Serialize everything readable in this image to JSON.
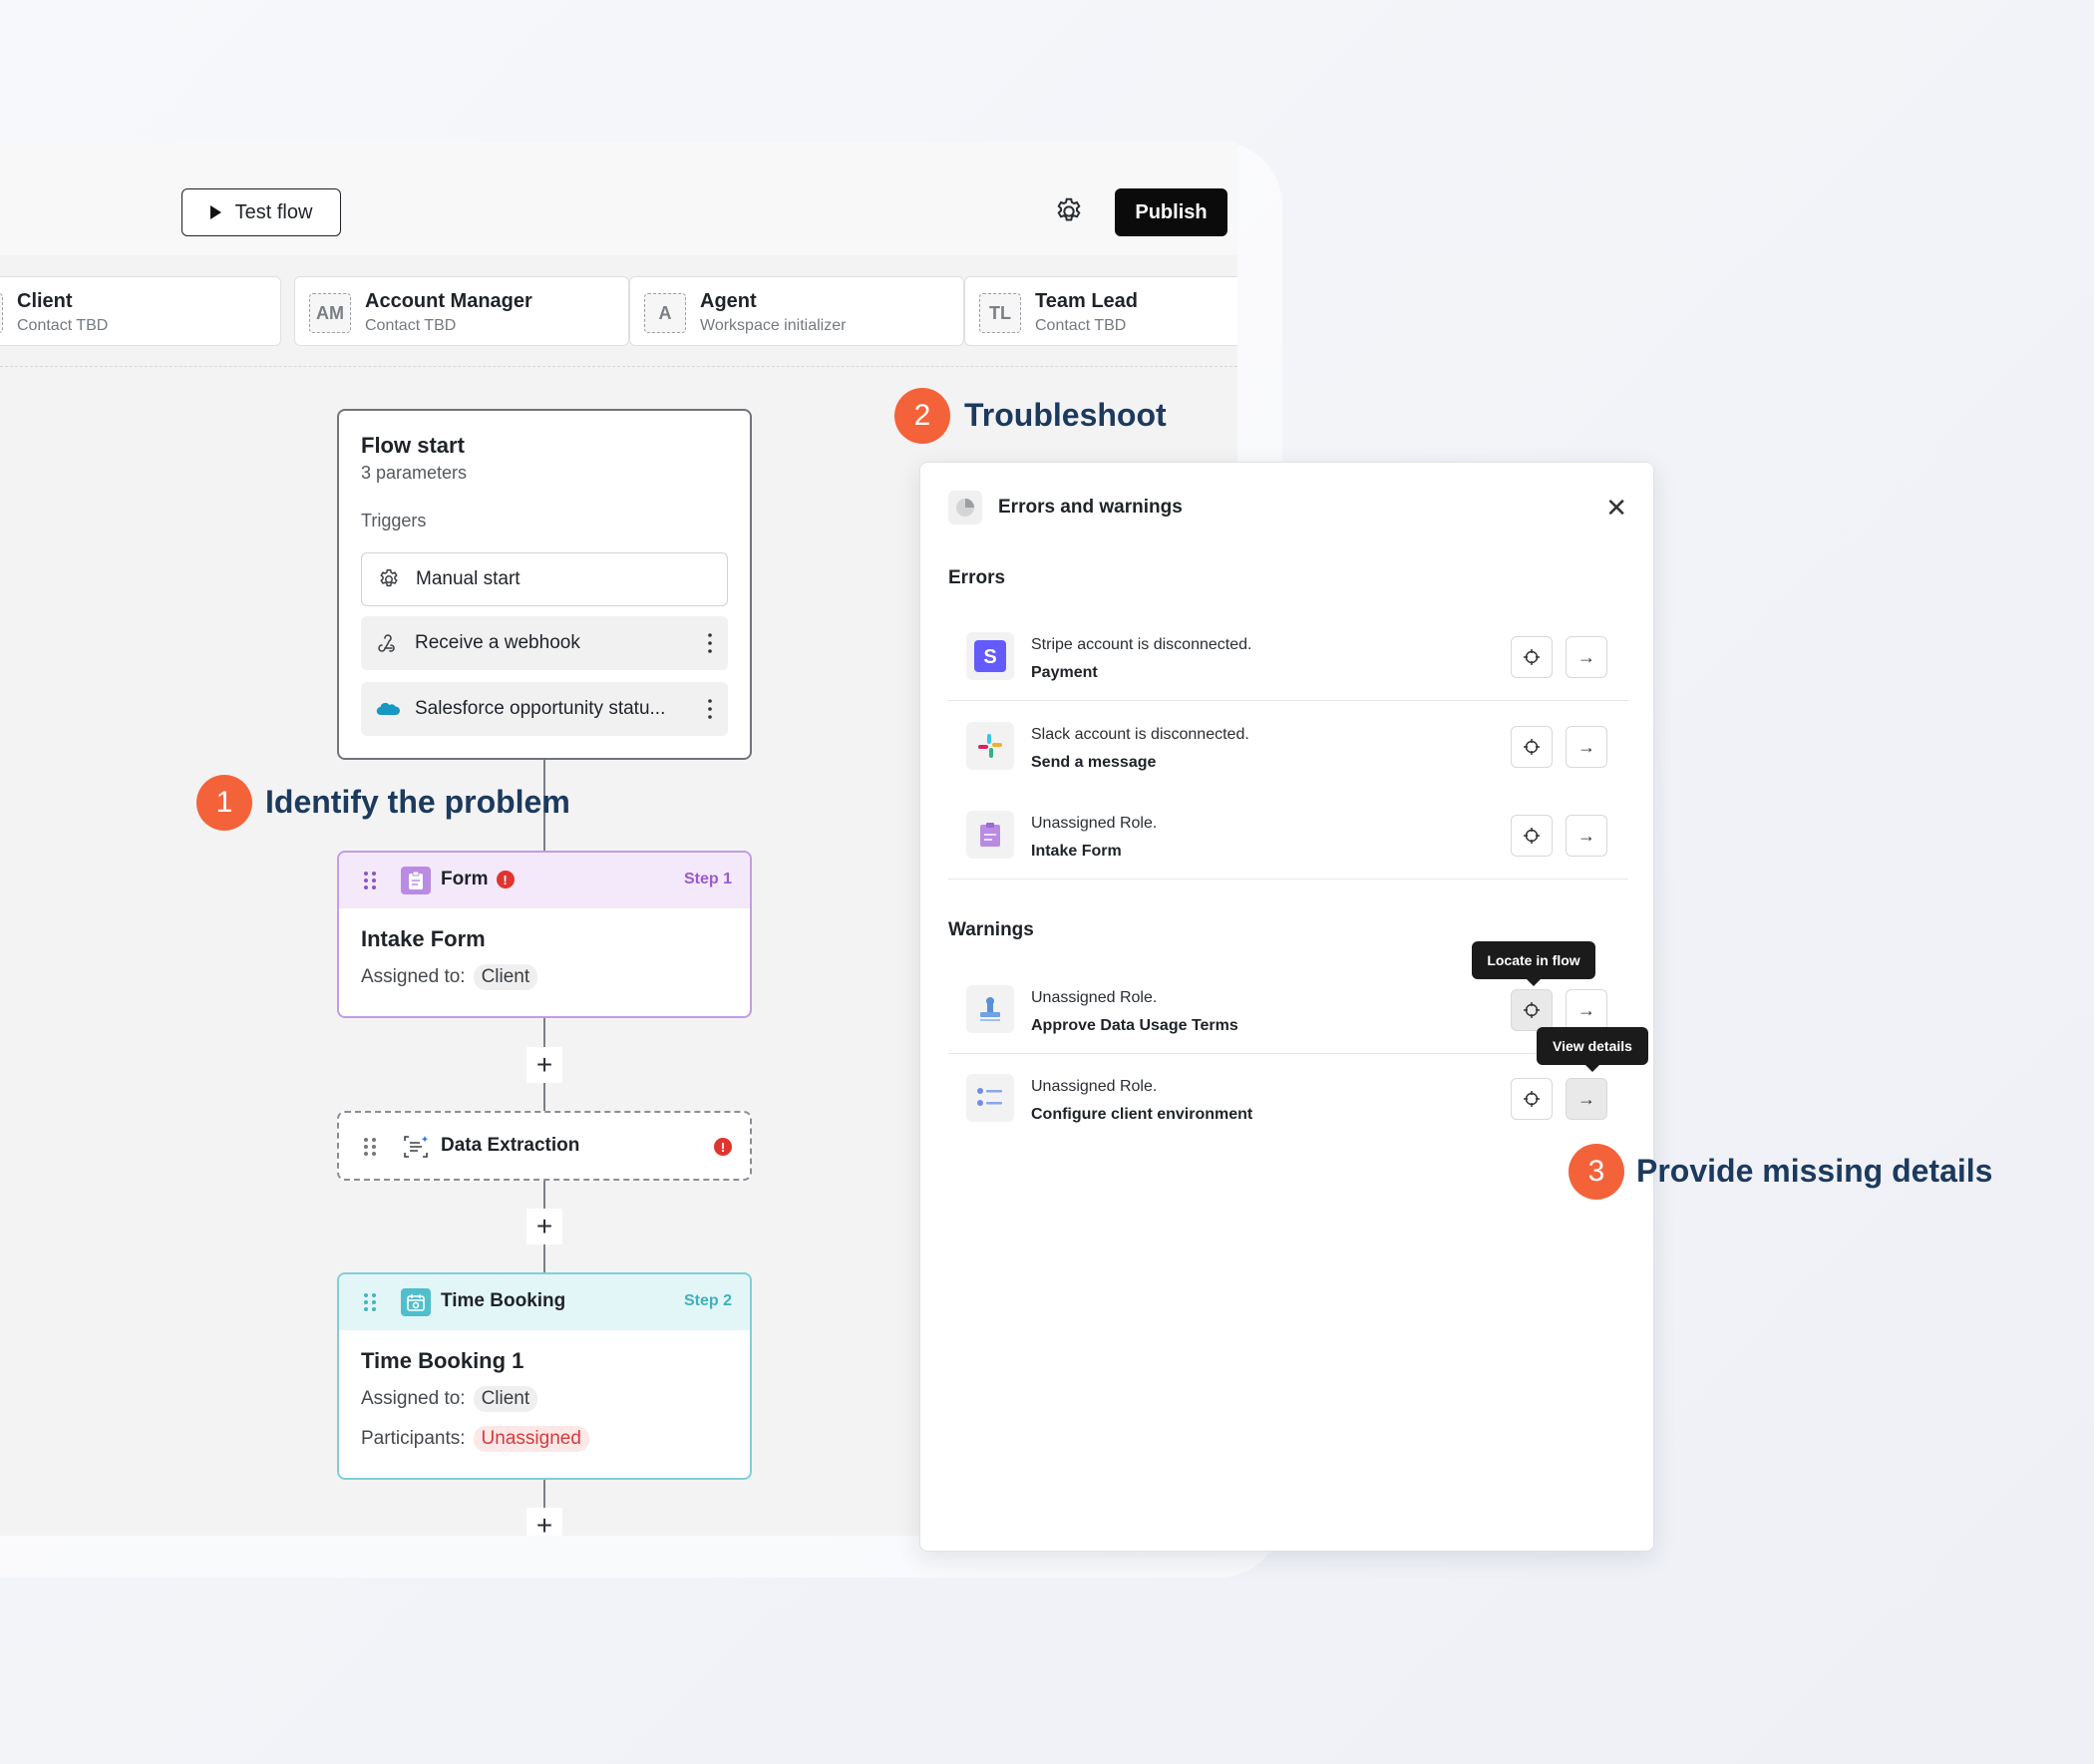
{
  "toolbar": {
    "test_flow_label": "Test flow",
    "publish_label": "Publish"
  },
  "roles": [
    {
      "initials": "C",
      "name": "Client",
      "subtitle": "Contact TBD"
    },
    {
      "initials": "AM",
      "name": "Account Manager",
      "subtitle": "Contact TBD"
    },
    {
      "initials": "A",
      "name": "Agent",
      "subtitle": "Workspace initializer"
    },
    {
      "initials": "TL",
      "name": "Team Lead",
      "subtitle": "Contact TBD"
    }
  ],
  "flow_start": {
    "title": "Flow start",
    "parameters": "3 parameters",
    "triggers_label": "Triggers",
    "triggers": [
      {
        "label": "Manual start",
        "icon": "gear-icon"
      },
      {
        "label": "Receive a webhook",
        "icon": "webhook-icon"
      },
      {
        "label": "Salesforce opportunity statu...",
        "icon": "salesforce-icon"
      }
    ]
  },
  "nodes": {
    "form": {
      "type": "Form",
      "step": "Step 1",
      "title": "Intake Form",
      "assigned_label": "Assigned to:",
      "assigned_value": "Client"
    },
    "extraction": {
      "type": "Data Extraction"
    },
    "booking": {
      "type": "Time Booking",
      "step": "Step 2",
      "title": "Time Booking 1",
      "assigned_label": "Assigned to:",
      "assigned_value": "Client",
      "participants_label": "Participants:",
      "participants_value": "Unassigned"
    }
  },
  "callouts": [
    {
      "number": "1",
      "text": "Identify the problem"
    },
    {
      "number": "2",
      "text": "Troubleshoot"
    },
    {
      "number": "3",
      "text": "Provide missing details"
    }
  ],
  "panel": {
    "title": "Errors and warnings",
    "errors_label": "Errors",
    "warnings_label": "Warnings",
    "errors": [
      {
        "message": "Stripe account is disconnected.",
        "target": "Payment",
        "icon": "stripe-icon"
      },
      {
        "message": "Slack account is disconnected.",
        "target": "Send a message",
        "icon": "slack-icon"
      },
      {
        "message": "Unassigned Role.",
        "target": "Intake Form",
        "icon": "form-icon"
      }
    ],
    "warnings": [
      {
        "message": "Unassigned Role.",
        "target": "Approve Data Usage Terms",
        "icon": "stamp-icon"
      },
      {
        "message": "Unassigned Role.",
        "target": "Configure client environment",
        "icon": "checklist-icon"
      }
    ],
    "tooltip_locate": "Locate in flow",
    "tooltip_details": "View details"
  },
  "colors": {
    "accent_orange": "#f4623a",
    "callout_text": "#1c3a5e",
    "form_purple": "#c39ce6",
    "booking_teal": "#7fcfd8",
    "error_red": "#e0352f"
  }
}
